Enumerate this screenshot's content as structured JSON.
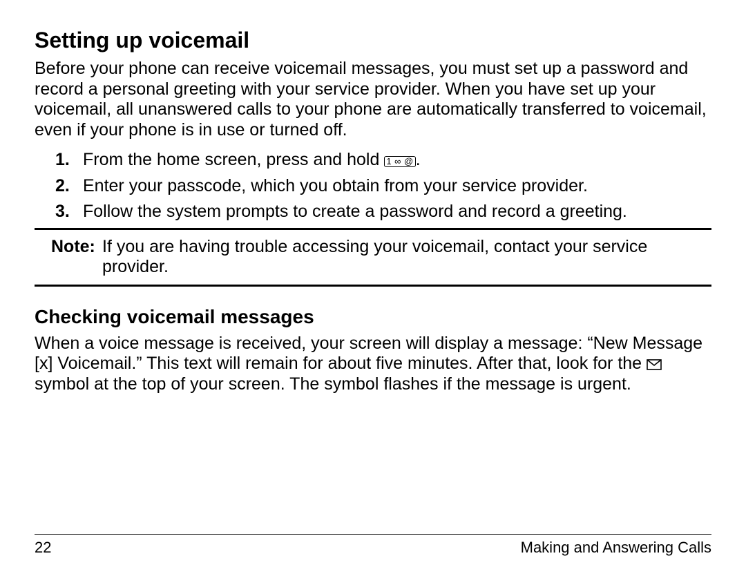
{
  "heading1": "Setting up voicemail",
  "intro": "Before your phone can receive voicemail messages, you must set up a password and record a personal greeting with your service provider. When you have set up your voicemail, all unanswered calls to your phone are automatically transferred to voicemail, even if your phone is in use or turned off.",
  "steps": {
    "n1": "1.",
    "s1_before": "From the home screen, press and hold ",
    "s1_key": "1 ∞ @",
    "s1_after": ".",
    "n2": "2.",
    "s2": "Enter your passcode, which you obtain from your service provider.",
    "n3": "3.",
    "s3": "Follow the system prompts to create a password and record a greeting."
  },
  "note": {
    "label": "Note:",
    "text": "If you are having trouble accessing your voicemail, contact your service provider."
  },
  "heading2": "Checking voicemail messages",
  "check_before": "When a voice message is received, your screen will display a message: “New Message [x] Voicemail.” This text will remain for about five minutes. After that, look for the ",
  "check_after": " symbol at the top of your screen. The symbol flashes if the message is urgent.",
  "footer": {
    "page": "22",
    "section": "Making and Answering Calls"
  }
}
